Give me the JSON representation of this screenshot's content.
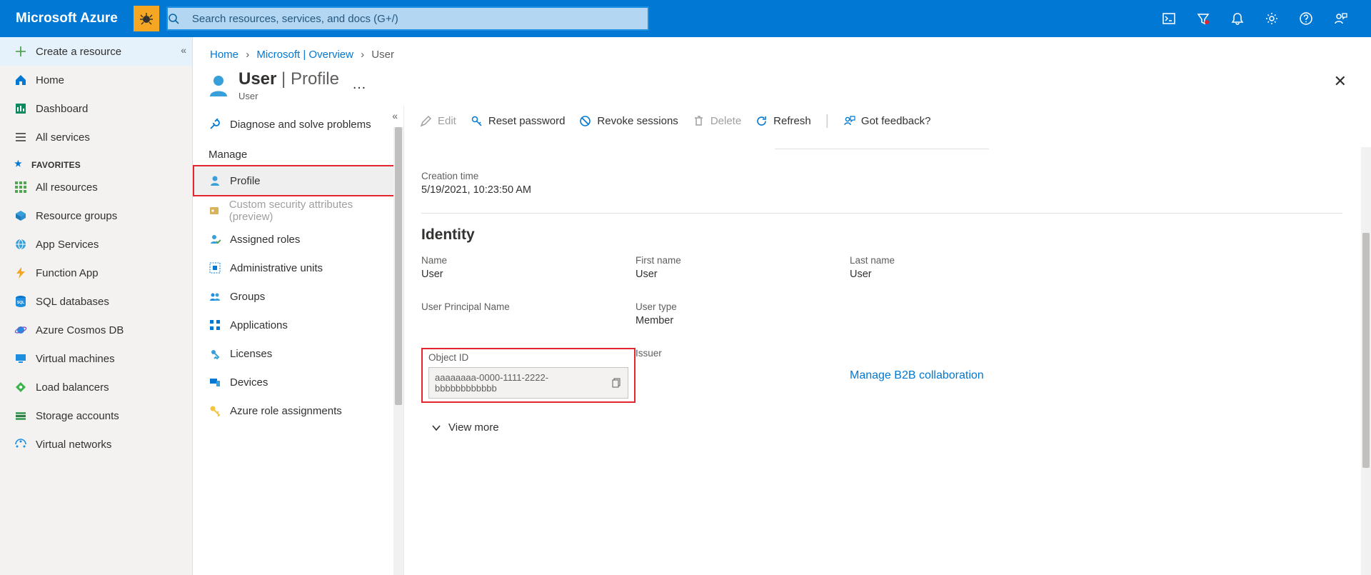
{
  "brand": "Microsoft Azure",
  "search": {
    "placeholder": "Search resources, services, and docs (G+/)"
  },
  "leftnav": {
    "create": "Create a resource",
    "home": "Home",
    "dashboard": "Dashboard",
    "all_services": "All services",
    "favorites_header": "FAVORITES",
    "favorites": [
      "All resources",
      "Resource groups",
      "App Services",
      "Function App",
      "SQL databases",
      "Azure Cosmos DB",
      "Virtual machines",
      "Load balancers",
      "Storage accounts",
      "Virtual networks"
    ]
  },
  "breadcrumb": {
    "home": "Home",
    "mid": "Microsoft | Overview",
    "cur": "User"
  },
  "blade": {
    "title_strong": "User",
    "title_thin": " | Profile",
    "subtitle": "User",
    "more": "…"
  },
  "subnav": {
    "diagnose": "Diagnose and solve problems",
    "manage_header": "Manage",
    "items": {
      "profile": "Profile",
      "csa": "Custom security attributes (preview)",
      "roles": "Assigned roles",
      "units": "Administrative units",
      "groups": "Groups",
      "apps": "Applications",
      "licenses": "Licenses",
      "devices": "Devices",
      "rbac": "Azure role assignments"
    }
  },
  "commands": {
    "edit": "Edit",
    "reset": "Reset password",
    "revoke": "Revoke sessions",
    "delete": "Delete",
    "refresh": "Refresh",
    "feedback": "Got feedback?"
  },
  "profile": {
    "creation_label": "Creation time",
    "creation_value": "5/19/2021, 10:23:50 AM",
    "identity_header": "Identity",
    "name_label": "Name",
    "name_value": "User",
    "first_label": "First name",
    "first_value": "User",
    "last_label": "Last name",
    "last_value": "User",
    "upn_label": "User Principal Name",
    "utype_label": "User type",
    "utype_value": "Member",
    "objid_label": "Object ID",
    "objid_value": "aaaaaaaa-0000-1111-2222-bbbbbbbbbbbb",
    "issuer_label": "Issuer",
    "b2b_link": "Manage B2B collaboration",
    "view_more": "View more"
  }
}
